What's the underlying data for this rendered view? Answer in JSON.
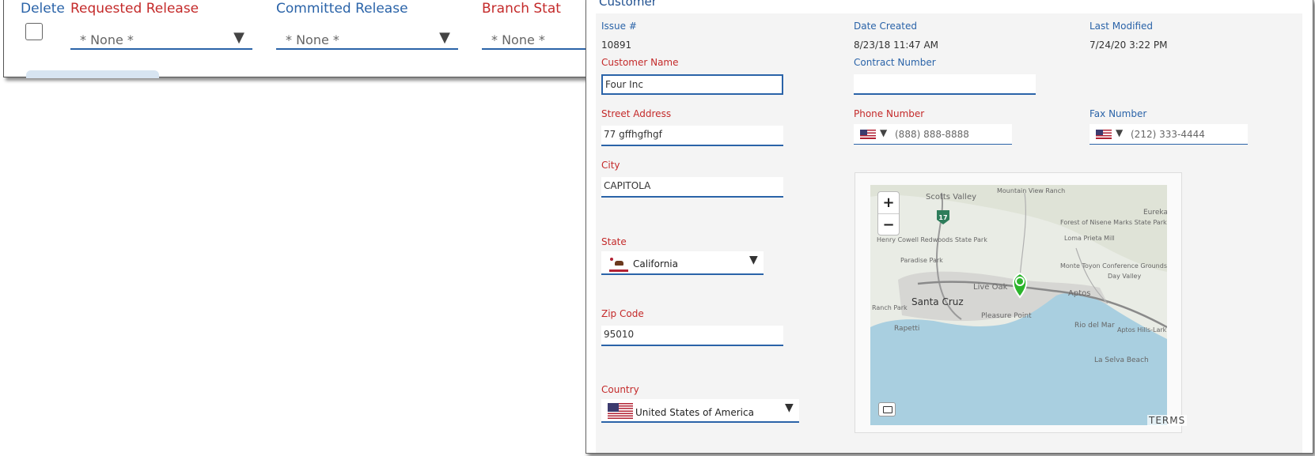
{
  "background_panel": {
    "delete_label": "Delete",
    "columns": [
      {
        "label": "Requested Release",
        "value": "* None *"
      },
      {
        "label": "Committed Release",
        "value": "* None *"
      },
      {
        "label": "Branch Stat",
        "value": "* None *"
      }
    ]
  },
  "customer": {
    "title": "Customer",
    "issue_label": "Issue #",
    "issue_value": "10891",
    "date_created_label": "Date Created",
    "date_created_value": "8/23/18 11:47 AM",
    "last_modified_label": "Last Modified",
    "last_modified_value": "7/24/20 3:22 PM",
    "customer_name_label": "Customer Name",
    "customer_name_value": "Four Inc",
    "contract_number_label": "Contract Number",
    "contract_number_value": "",
    "street_label": "Street Address",
    "street_value": "77 gffhgfhgf",
    "phone_label": "Phone Number",
    "phone_placeholder": "(888) 888-8888",
    "fax_label": "Fax Number",
    "fax_placeholder": "(212) 333-4444",
    "city_label": "City",
    "city_value": "CAPITOLA",
    "state_label": "State",
    "state_value": "California",
    "zip_label": "Zip Code",
    "zip_value": "95010",
    "country_label": "Country",
    "country_value": "United States of America"
  },
  "map": {
    "places": [
      "Mountain View Ranch",
      "Scotts Valley",
      "Eureka",
      "Forest of Nisene Marks State Park",
      "Loma Prieta Mill",
      "Henry Cowell Redwoods State Park",
      "Paradise Park",
      "Monte Toyon Conference Grounds",
      "Day Valley",
      "Live Oak",
      "Aptos",
      "Santa Cruz",
      "Pleasure Point",
      "Rapetti",
      "Rio del Mar",
      "Aptos Hills-Larkin Valley",
      "La Selva Beach",
      "Ranch Park"
    ],
    "highway_shield": "17",
    "zoom_in": "+",
    "zoom_out": "−",
    "terms": "TERMS",
    "colors": {
      "land": "#e9ece5",
      "water": "#a9cfe0",
      "marker": "#2bb42b",
      "shield": "#2e7d5b"
    }
  },
  "colors": {
    "label_blue": "#2a63a8",
    "label_red": "#c42a2a",
    "underline": "#2a63a8"
  }
}
